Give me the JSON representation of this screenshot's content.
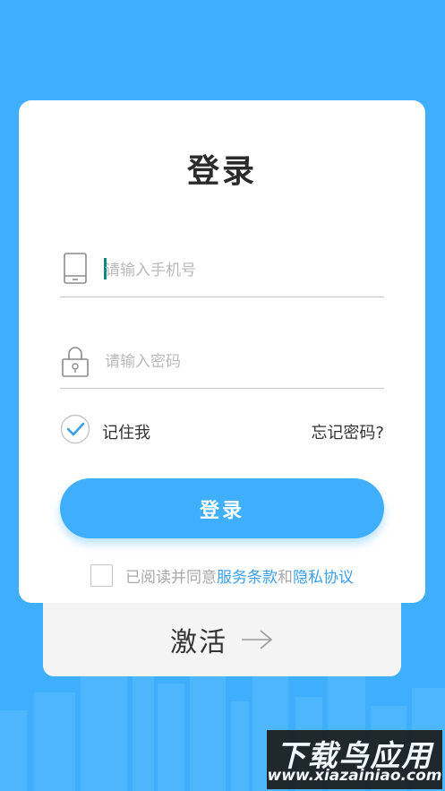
{
  "login": {
    "title": "登录",
    "phone_placeholder": "请输入手机号",
    "password_placeholder": "请输入密码",
    "remember_label": "记住我",
    "remember_checked": true,
    "forgot_label": "忘记密码?",
    "submit_label": "登录",
    "agree_prefix": "已阅读并同意",
    "terms_link": "服务条款",
    "and_text": "和",
    "privacy_link": "隐私协议"
  },
  "activate": {
    "label": "激活",
    "icon": "arrow-right-icon"
  },
  "watermark": {
    "title": "下载鸟应用",
    "url": "www.xiazainiao.com"
  },
  "colors": {
    "background": "#3eaefd",
    "accent": "#3eaefd",
    "link": "#3a9fe8",
    "caret": "#0d8b7c"
  }
}
